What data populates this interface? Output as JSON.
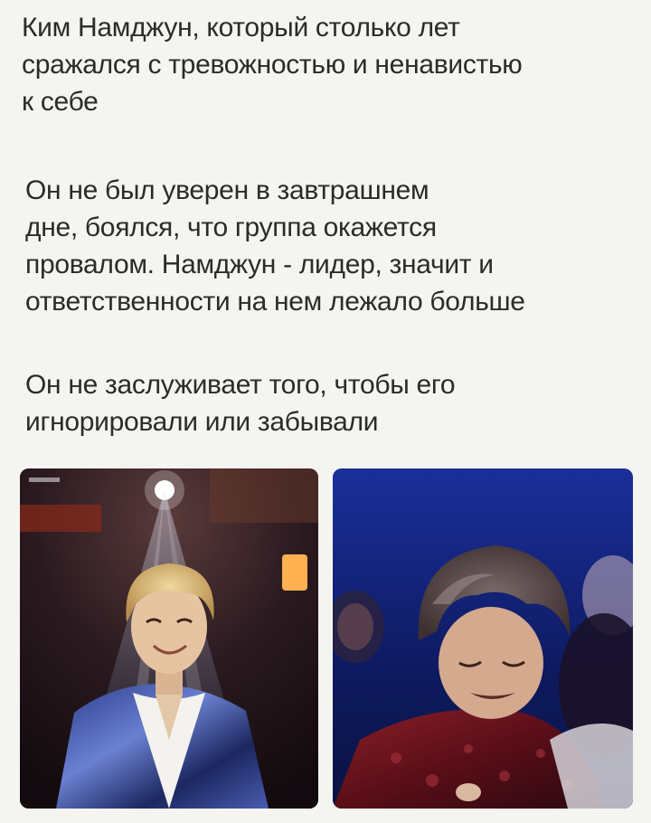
{
  "paragraphs": [
    {
      "lines": [
        "Ким Намджун, который столько лет",
        "сражался с тревожностью и ненавистью",
        "к себе"
      ]
    },
    {
      "lines": [
        "Он не был уверен в завтрашнем",
        "дне, боялся, что группа окажется",
        "провалом. Намджун - лидер, значит и",
        "ответственности на нем лежало больше"
      ]
    },
    {
      "lines": [
        "Он не заслуживает того, чтобы его",
        "игнорировали или забывали"
      ]
    }
  ],
  "photos": [
    {
      "description_icon": "photo-smiling-on-stage"
    },
    {
      "description_icon": "photo-crying-embrace"
    }
  ],
  "colors": {
    "background": "#f4f4f1",
    "text": "#2b2b2b"
  }
}
